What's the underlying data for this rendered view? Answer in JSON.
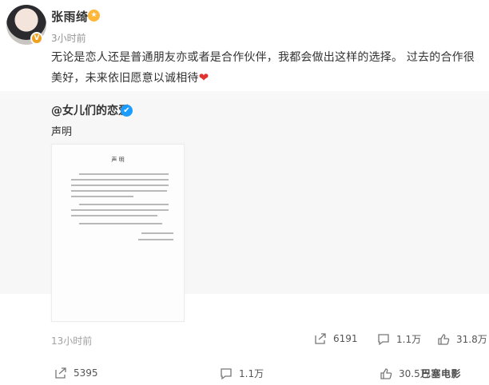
{
  "author": {
    "name": "张雨绮",
    "time": "3小时前",
    "avatar_badge": "V"
  },
  "post": {
    "text": "无论是恋人还是普通朋友亦或者是合作伙伴，我都会做出这样的选择。 过去的合作很美好，未来依旧愿意以诚相待",
    "emoji": "❤"
  },
  "repost": {
    "author": "@女儿们的恋爱",
    "text": "声明",
    "document_title": "声 明",
    "time": "13小时前",
    "stats": {
      "reposts": "6191",
      "comments": "1.1万",
      "likes": "31.8万"
    }
  },
  "footer_stats": {
    "reposts": "5395",
    "comments": "1.1万",
    "likes": "30.5万"
  },
  "watermark": "巴塞电影",
  "colors": {
    "accent_blue": "#1d9cff",
    "vip_orange": "#ffb739",
    "heart_red": "#e0322f"
  }
}
